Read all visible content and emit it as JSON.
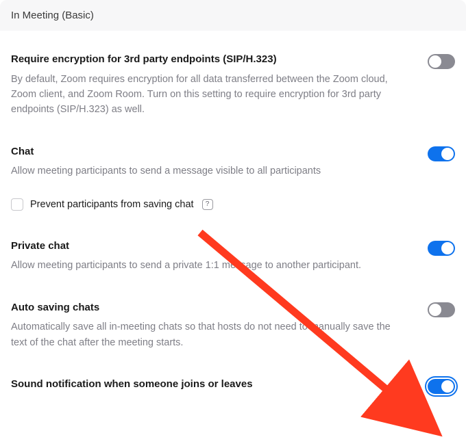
{
  "section": {
    "title": "In Meeting (Basic)"
  },
  "settings": {
    "encryption": {
      "title": "Require encryption for 3rd party endpoints (SIP/H.323)",
      "desc": "By default, Zoom requires encryption for all data transferred between the Zoom cloud, Zoom client, and Zoom Room. Turn on this setting to require encryption for 3rd party endpoints (SIP/H.323) as well.",
      "on": false
    },
    "chat": {
      "title": "Chat",
      "desc": "Allow meeting participants to send a message visible to all participants",
      "on": true,
      "prevent_save": {
        "label": "Prevent participants from saving chat",
        "checked": false,
        "help": "?"
      }
    },
    "private_chat": {
      "title": "Private chat",
      "desc": "Allow meeting participants to send a private 1:1 message to another participant.",
      "on": true
    },
    "auto_save": {
      "title": "Auto saving chats",
      "desc": "Automatically save all in-meeting chats so that hosts do not need to manually save the text of the chat after the meeting starts.",
      "on": false
    },
    "sound_notif": {
      "title": "Sound notification when someone joins or leaves",
      "on": true
    }
  },
  "annotation": {
    "color": "#ff3a1f"
  }
}
